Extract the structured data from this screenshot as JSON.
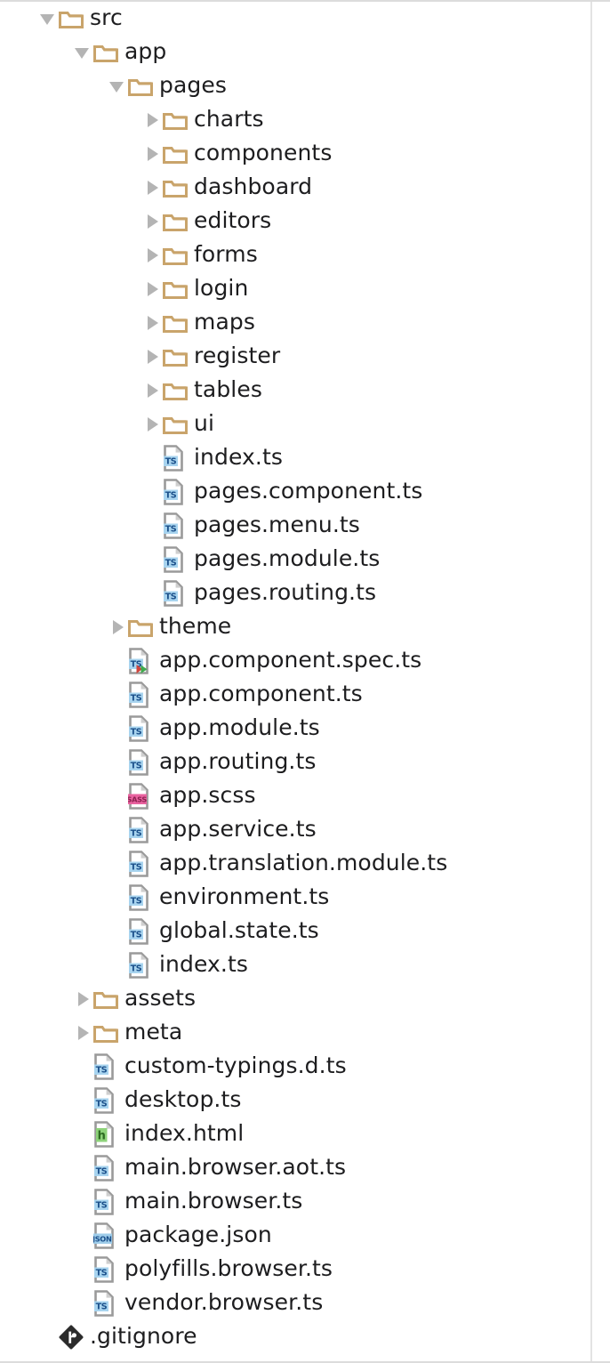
{
  "panel": {
    "title": "Project Explorer File Tree",
    "colors": {
      "background": "#ffffff",
      "folder": "#c9a46b",
      "text": "#1d1d1f",
      "arrow": "#b4b4b4",
      "ts_badge": "#a8d4ef",
      "ts_badge_text": "#1a4f8a",
      "sass_badge": "#e8629f",
      "sass_badge_text": "#8c1f4f",
      "html_badge": "#8ed37a",
      "html_badge_text": "#2d6b21",
      "json_badge": "#9fcdea",
      "json_badge_text": "#1a4f8a",
      "doc_outline": "#9a9a9a",
      "git_icon": "#2b2b2b"
    }
  },
  "tree": {
    "rows": [
      {
        "label": "src",
        "depth": 0,
        "icon": "folder-icon",
        "state": "expanded"
      },
      {
        "label": "app",
        "depth": 1,
        "icon": "folder-icon",
        "state": "expanded"
      },
      {
        "label": "pages",
        "depth": 2,
        "icon": "folder-icon",
        "state": "expanded"
      },
      {
        "label": "charts",
        "depth": 3,
        "icon": "folder-icon",
        "state": "collapsed"
      },
      {
        "label": "components",
        "depth": 3,
        "icon": "folder-icon",
        "state": "collapsed"
      },
      {
        "label": "dashboard",
        "depth": 3,
        "icon": "folder-icon",
        "state": "collapsed"
      },
      {
        "label": "editors",
        "depth": 3,
        "icon": "folder-icon",
        "state": "collapsed"
      },
      {
        "label": "forms",
        "depth": 3,
        "icon": "folder-icon",
        "state": "collapsed"
      },
      {
        "label": "login",
        "depth": 3,
        "icon": "folder-icon",
        "state": "collapsed"
      },
      {
        "label": "maps",
        "depth": 3,
        "icon": "folder-icon",
        "state": "collapsed"
      },
      {
        "label": "register",
        "depth": 3,
        "icon": "folder-icon",
        "state": "collapsed"
      },
      {
        "label": "tables",
        "depth": 3,
        "icon": "folder-icon",
        "state": "collapsed"
      },
      {
        "label": "ui",
        "depth": 3,
        "icon": "folder-icon",
        "state": "collapsed"
      },
      {
        "label": "index.ts",
        "depth": 3,
        "icon": "typescript-file-icon",
        "state": "leaf"
      },
      {
        "label": "pages.component.ts",
        "depth": 3,
        "icon": "typescript-file-icon",
        "state": "leaf"
      },
      {
        "label": "pages.menu.ts",
        "depth": 3,
        "icon": "typescript-file-icon",
        "state": "leaf"
      },
      {
        "label": "pages.module.ts",
        "depth": 3,
        "icon": "typescript-file-icon",
        "state": "leaf"
      },
      {
        "label": "pages.routing.ts",
        "depth": 3,
        "icon": "typescript-file-icon",
        "state": "leaf"
      },
      {
        "label": "theme",
        "depth": 2,
        "icon": "folder-icon",
        "state": "collapsed"
      },
      {
        "label": "app.component.spec.ts",
        "depth": 2,
        "icon": "typescript-spec-file-icon",
        "state": "leaf"
      },
      {
        "label": "app.component.ts",
        "depth": 2,
        "icon": "typescript-file-icon",
        "state": "leaf"
      },
      {
        "label": "app.module.ts",
        "depth": 2,
        "icon": "typescript-file-icon",
        "state": "leaf"
      },
      {
        "label": "app.routing.ts",
        "depth": 2,
        "icon": "typescript-file-icon",
        "state": "leaf"
      },
      {
        "label": "app.scss",
        "depth": 2,
        "icon": "sass-file-icon",
        "state": "leaf"
      },
      {
        "label": "app.service.ts",
        "depth": 2,
        "icon": "typescript-file-icon",
        "state": "leaf"
      },
      {
        "label": "app.translation.module.ts",
        "depth": 2,
        "icon": "typescript-file-icon",
        "state": "leaf"
      },
      {
        "label": "environment.ts",
        "depth": 2,
        "icon": "typescript-file-icon",
        "state": "leaf"
      },
      {
        "label": "global.state.ts",
        "depth": 2,
        "icon": "typescript-file-icon",
        "state": "leaf"
      },
      {
        "label": "index.ts",
        "depth": 2,
        "icon": "typescript-file-icon",
        "state": "leaf"
      },
      {
        "label": "assets",
        "depth": 1,
        "icon": "folder-icon",
        "state": "collapsed"
      },
      {
        "label": "meta",
        "depth": 1,
        "icon": "folder-icon",
        "state": "collapsed"
      },
      {
        "label": "custom-typings.d.ts",
        "depth": 1,
        "icon": "typescript-file-icon",
        "state": "leaf"
      },
      {
        "label": "desktop.ts",
        "depth": 1,
        "icon": "typescript-file-icon",
        "state": "leaf"
      },
      {
        "label": "index.html",
        "depth": 1,
        "icon": "html-file-icon",
        "state": "leaf"
      },
      {
        "label": "main.browser.aot.ts",
        "depth": 1,
        "icon": "typescript-file-icon",
        "state": "leaf"
      },
      {
        "label": "main.browser.ts",
        "depth": 1,
        "icon": "typescript-file-icon",
        "state": "leaf"
      },
      {
        "label": "package.json",
        "depth": 1,
        "icon": "json-file-icon",
        "state": "leaf"
      },
      {
        "label": "polyfills.browser.ts",
        "depth": 1,
        "icon": "typescript-file-icon",
        "state": "leaf"
      },
      {
        "label": "vendor.browser.ts",
        "depth": 1,
        "icon": "typescript-file-icon",
        "state": "leaf"
      },
      {
        "label": ".gitignore",
        "depth": 0,
        "icon": "git-file-icon",
        "state": "leaf"
      }
    ]
  }
}
